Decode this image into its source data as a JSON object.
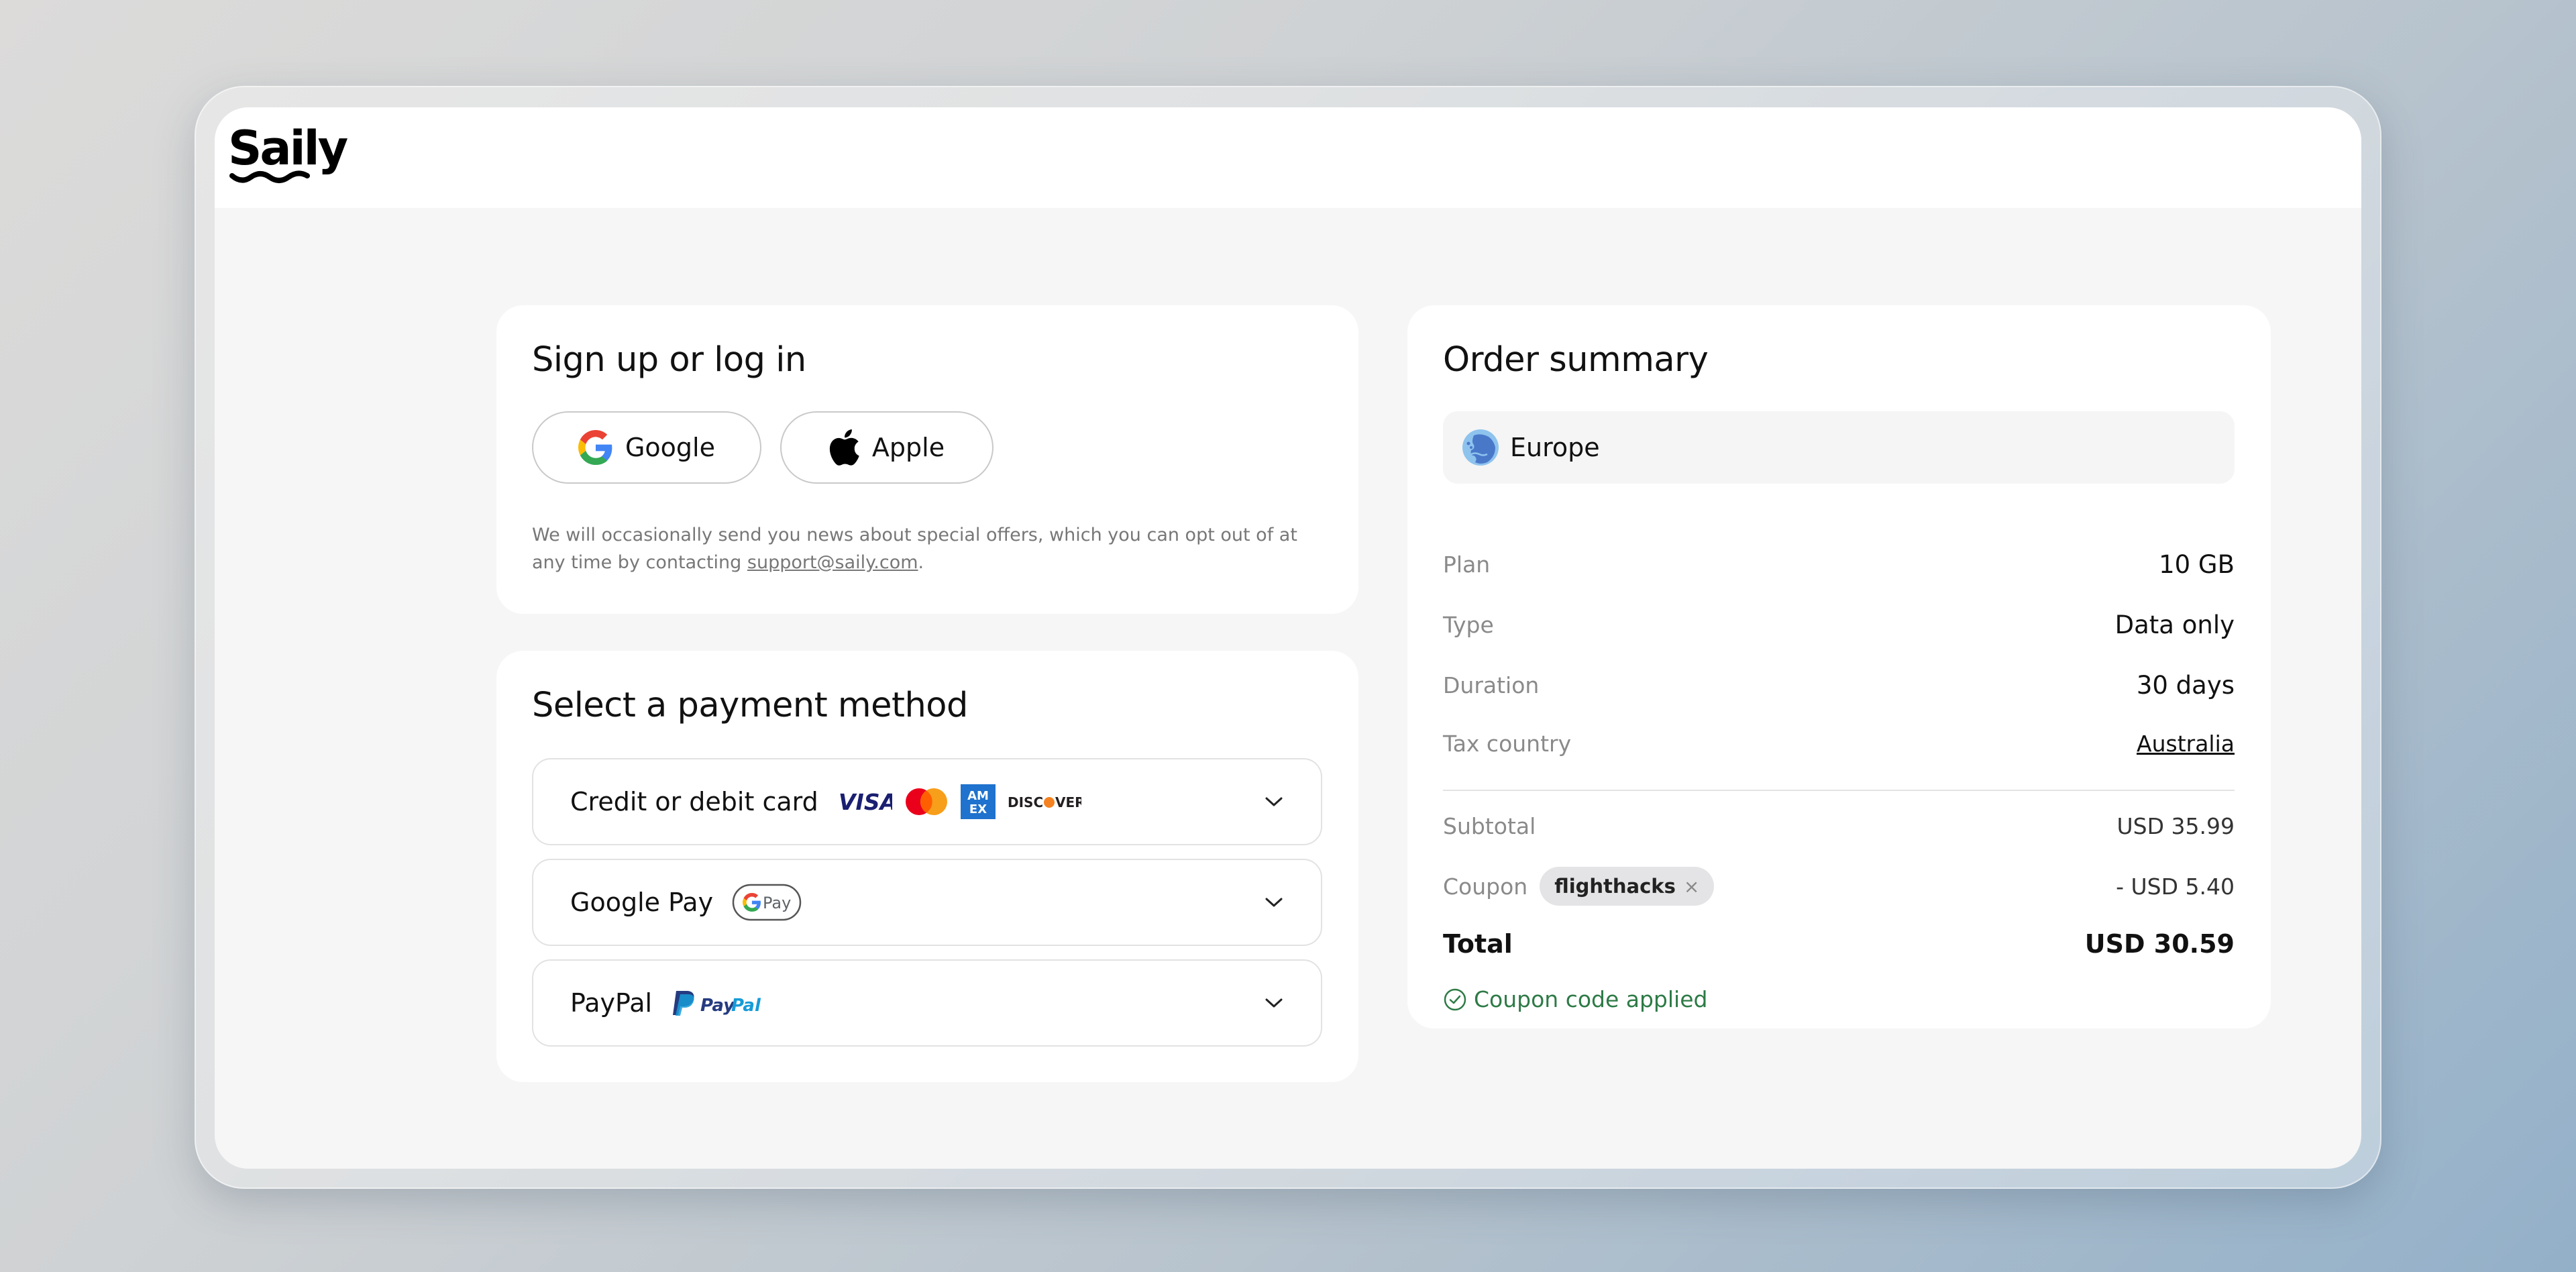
{
  "brand": {
    "name": "Saily"
  },
  "signup": {
    "title": "Sign up or log in",
    "google_label": "Google",
    "apple_label": "Apple",
    "notice_text": "We will occasionally send you news about special offers, which you can opt out of at any time by contacting ",
    "support_email": "support@saily.com",
    "notice_end": "."
  },
  "payment": {
    "title": "Select a payment method",
    "options": [
      {
        "label": "Credit or debit card",
        "icons": [
          "visa-icon",
          "mastercard-icon",
          "amex-icon",
          "discover-icon"
        ]
      },
      {
        "label": "Google Pay",
        "icons": [
          "google-pay-icon"
        ]
      },
      {
        "label": "PayPal",
        "icons": [
          "paypal-icon"
        ]
      }
    ],
    "brand_text": {
      "visa": "VISA",
      "amex_top": "AM",
      "amex_bottom": "EX",
      "discover_a": "DISC",
      "discover_b": "VER",
      "gpay": "Pay",
      "paypal_a": "Pay",
      "paypal_b": "Pal"
    }
  },
  "summary": {
    "title": "Order summary",
    "region": "Europe",
    "rows": [
      {
        "label": "Plan",
        "value": "10 GB"
      },
      {
        "label": "Type",
        "value": "Data only"
      },
      {
        "label": "Duration",
        "value": "30 days"
      },
      {
        "label": "Tax country",
        "value": "Australia"
      }
    ],
    "subtotal_label": "Subtotal",
    "subtotal_value": "USD 35.99",
    "coupon_label": "Coupon",
    "coupon_code": "flighthacks",
    "coupon_remove": "×",
    "coupon_value": "- USD 5.40",
    "total_label": "Total",
    "total_value": "USD 30.59",
    "applied_text": "Coupon code applied"
  },
  "colors": {
    "accent_green": "#2d7a46",
    "visa_blue": "#1a1f71",
    "amex_blue": "#1f72cd",
    "mastercard_red": "#eb001b",
    "mastercard_orange": "#f79e1b",
    "paypal_dark": "#253b80",
    "paypal_light": "#179bd7"
  }
}
